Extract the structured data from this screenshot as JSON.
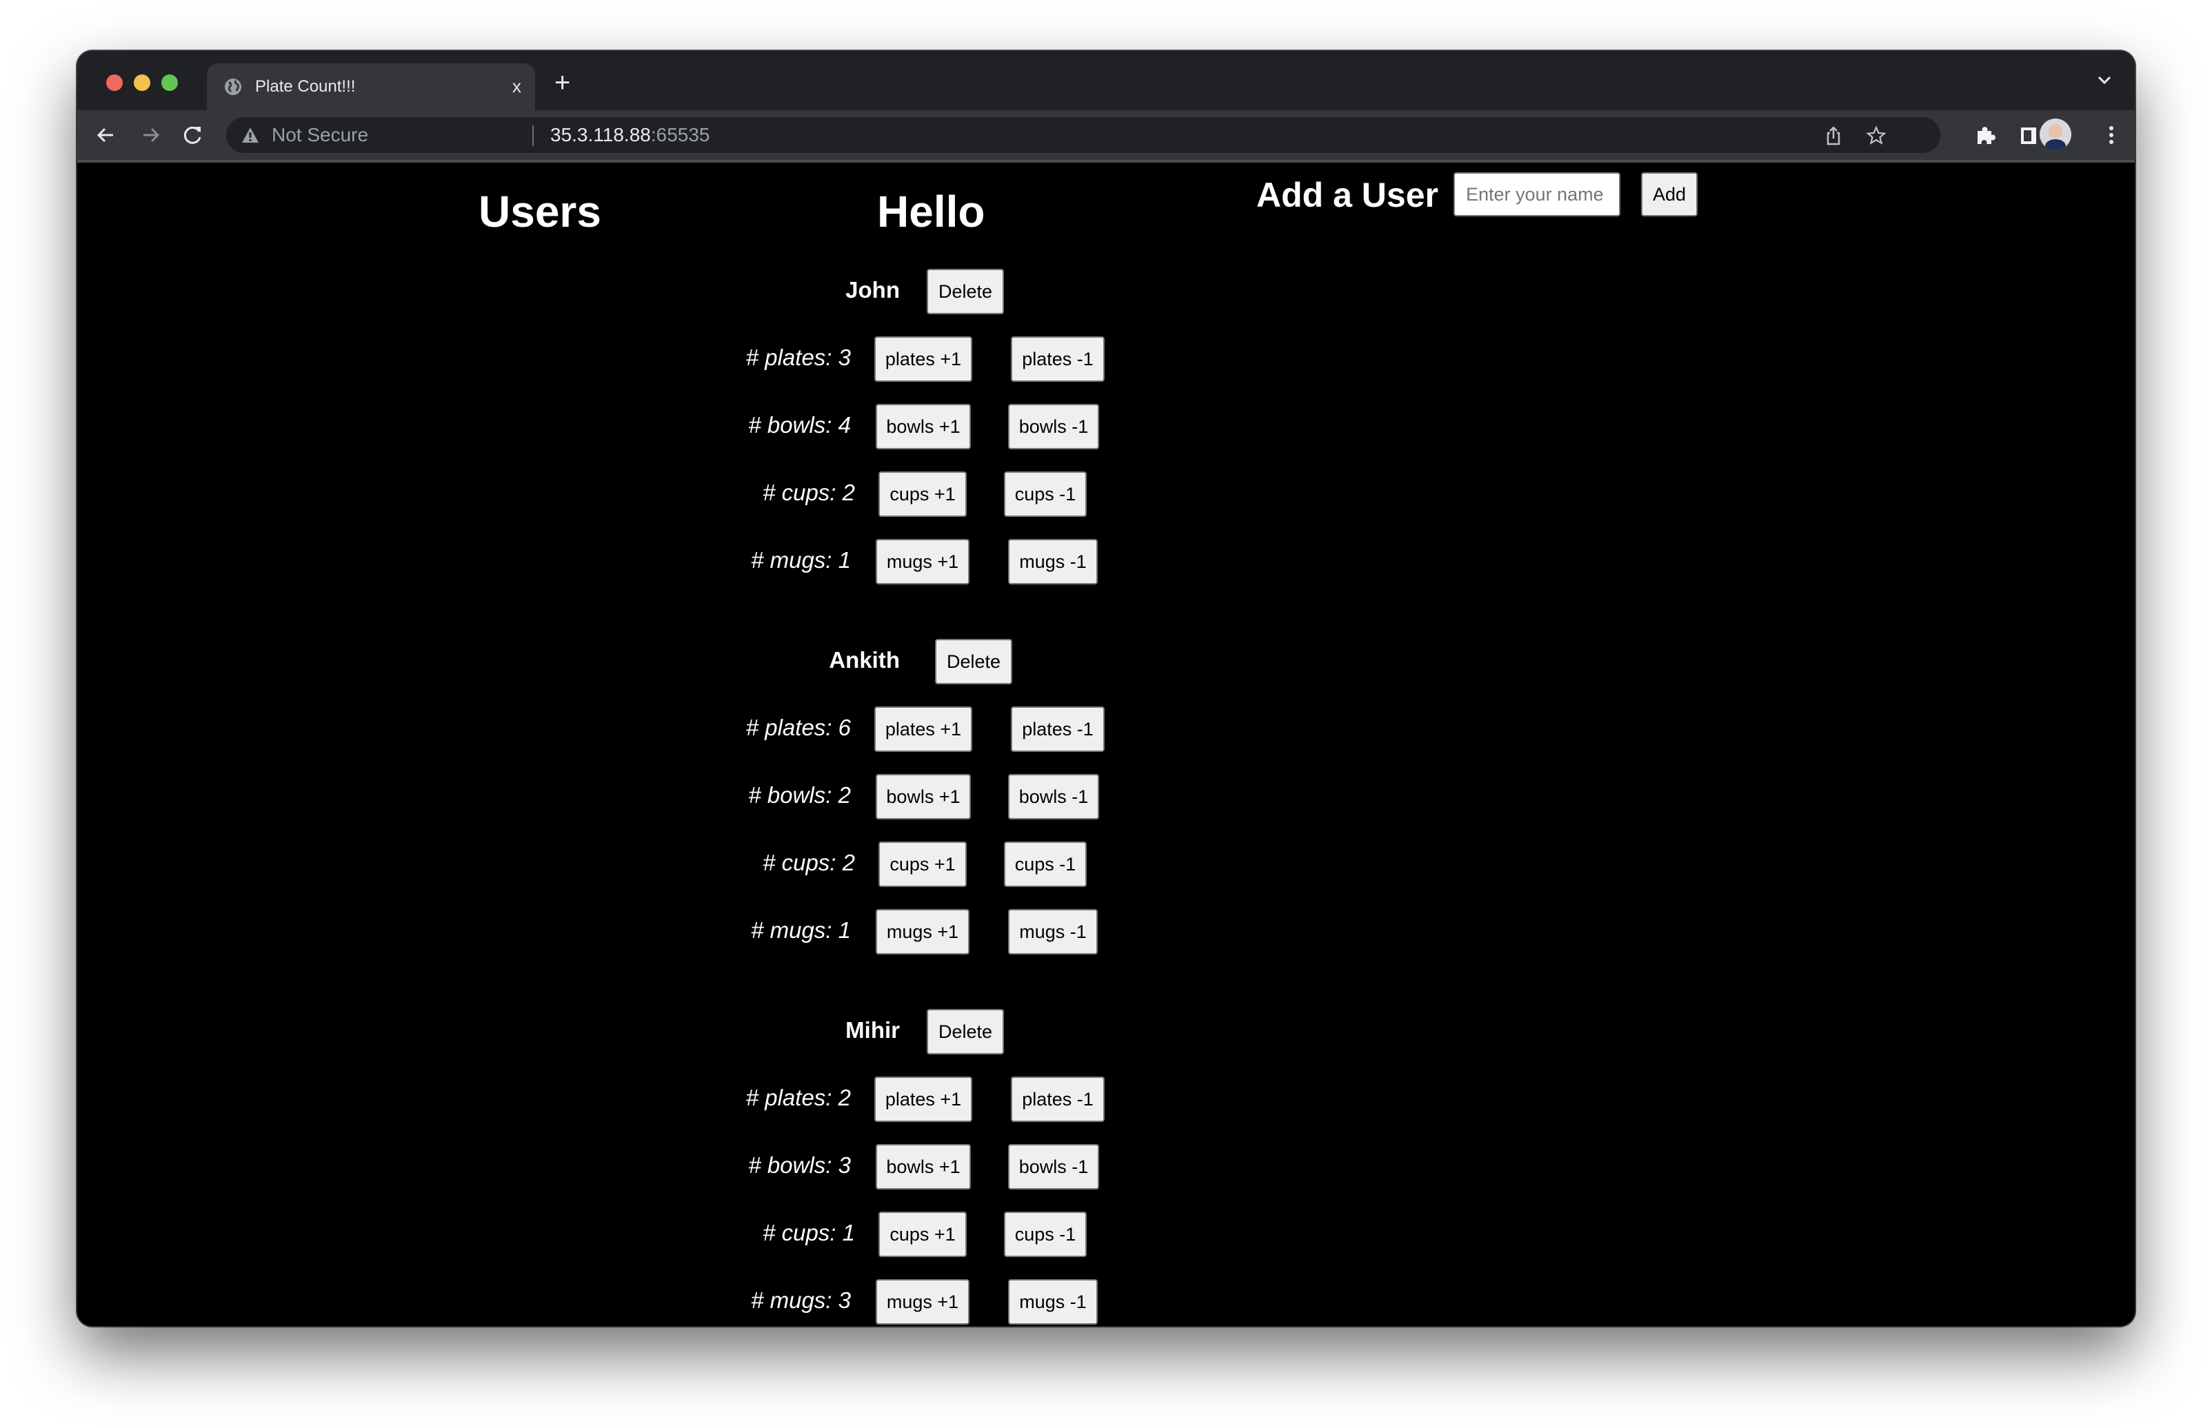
{
  "browser": {
    "tab_title": "Plate Count!!!",
    "tab_close": "x",
    "new_tab": "+",
    "security_label": "Not Secure",
    "url_host": "35.3.118.88",
    "url_port": ":65535"
  },
  "page": {
    "users_heading": "Users",
    "hello_heading": "Hello",
    "add_user_heading": "Add a User",
    "name_input_placeholder": "Enter your name",
    "name_input_value": "",
    "add_button": "Add",
    "delete_button": "Delete",
    "users": [
      {
        "name": "John",
        "items": [
          {
            "label": "# plates: 3",
            "plus": "plates +1",
            "minus": "plates -1"
          },
          {
            "label": "# bowls: 4",
            "plus": "bowls +1",
            "minus": "bowls -1"
          },
          {
            "label": "# cups: 2",
            "plus": "cups +1",
            "minus": "cups -1"
          },
          {
            "label": "# mugs: 1",
            "plus": "mugs +1",
            "minus": "mugs -1"
          }
        ]
      },
      {
        "name": "Ankith",
        "items": [
          {
            "label": "# plates: 6",
            "plus": "plates +1",
            "minus": "plates -1"
          },
          {
            "label": "# bowls: 2",
            "plus": "bowls +1",
            "minus": "bowls -1"
          },
          {
            "label": "# cups: 2",
            "plus": "cups +1",
            "minus": "cups -1"
          },
          {
            "label": "# mugs: 1",
            "plus": "mugs +1",
            "minus": "mugs -1"
          }
        ]
      },
      {
        "name": "Mihir",
        "items": [
          {
            "label": "# plates: 2",
            "plus": "plates +1",
            "minus": "plates -1"
          },
          {
            "label": "# bowls: 3",
            "plus": "bowls +1",
            "minus": "bowls -1"
          },
          {
            "label": "# cups: 1",
            "plus": "cups +1",
            "minus": "cups -1"
          },
          {
            "label": "# mugs: 3",
            "plus": "mugs +1",
            "minus": "mugs -1"
          }
        ]
      }
    ]
  }
}
